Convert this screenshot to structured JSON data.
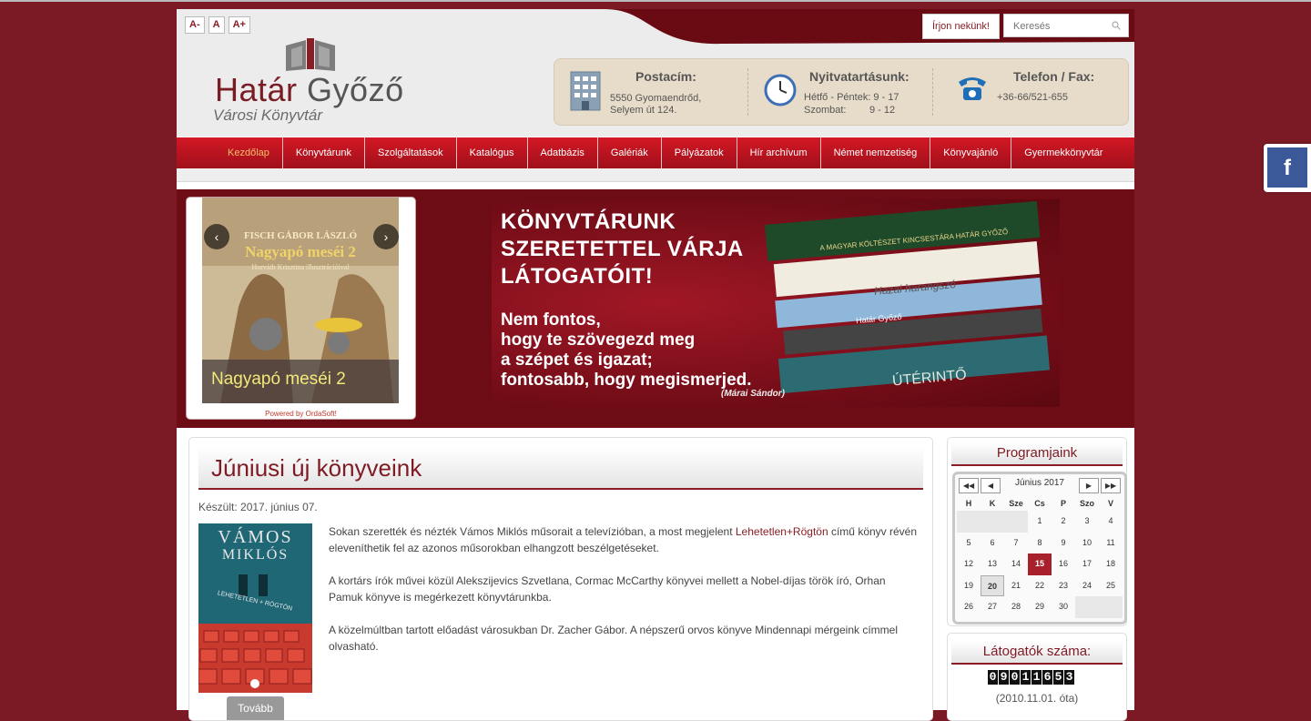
{
  "header": {
    "font_sizes": [
      "A-",
      "A",
      "A+"
    ],
    "logo_title_a": "Határ",
    "logo_title_b": "Győző",
    "logo_sub": "Városi Könyvtár",
    "write_us": "Írjon nekünk!",
    "search_placeholder": "Keresés",
    "postal_title": "Postacím:",
    "postal_line1": "5550 Gyomaendrőd,",
    "postal_line2": "Selyem út 124.",
    "hours_title": "Nyitvatartásunk:",
    "hours_line1": "Hétfő - Péntek: 9 - 17",
    "hours_line2_label": "Szombat:",
    "hours_line2_value": "9 - 12",
    "phone_title": "Telefon / Fax:",
    "phone_value": "+36-66/521-655"
  },
  "nav": {
    "items": [
      "Kezdőlap",
      "Könyvtárunk",
      "Szolgáltatások",
      "Katalógus",
      "Adatbázis",
      "Galériák",
      "Pályázatok",
      "Hír archívum",
      "Német nemzetiség",
      "Könyvajánló",
      "Gyermekkönyvtár"
    ]
  },
  "slider": {
    "book_author": "FISCH GÁBOR LÁSZLÓ",
    "book_title": "Nagyapó meséi 2",
    "book_sub": "Horváth Krisztina illusztrációival",
    "caption": "Nagyapó meséi 2",
    "powered": "Powered by OrdaSoft!",
    "prev": "‹",
    "next": "›"
  },
  "banner": {
    "line1": "KÖNYVTÁRUNK",
    "line2": "SZERETETTEL VÁRJA",
    "line3": "LÁTOGATÓIT!",
    "quote1": "Nem fontos,",
    "quote2": "hogy te szövegezd meg",
    "quote3": "a szépet és igazat;",
    "quote4": "fontosabb, hogy megismerjed.",
    "author": "(Márai Sándor)",
    "spine1": "A MAGYAR KÖLTÉSZET KINCSESTÁRA HATÁR GYŐZŐ",
    "spine2": "Hazai harangszó",
    "spine3": "Határ Győző",
    "spine4": "ÚTÉRINTŐ"
  },
  "article": {
    "title": "Júniusi új könyveink",
    "meta": "Készült: 2017. június 07.",
    "cover_author_1": "VÁMOS",
    "cover_author_2": "MIKLÓS",
    "cover_title": "LEHETETLEN + RÖGTÖN",
    "p1_a": "Sokan szerették és nézték Vámos Miklós műsorait a televízióban, a most megjelent ",
    "p1_link": "Lehetetlen+Rögtön",
    "p1_b": " című könyv révén eleveníthetik fel az azonos műsorokban elhangzott beszélgetéseket.",
    "p2": "A kortárs írók művei közül Alekszijevics Szvetlana, Cormac McCarthy könyvei mellett a Nobel-díjas török író, Orhan Pamuk könyve is megérkezett könyvtárunkba.",
    "p3": "A közelmúltban tartott előadást városukban Dr. Zacher Gábor. A népszerű orvos könyve Mindennapi mérgeink címmel olvasható.",
    "more": "Tovább"
  },
  "programs": {
    "title": "Programjaink",
    "month": "Június 2017",
    "nav_prev_year": "◀◀",
    "nav_prev": "◀",
    "nav_next": "▶",
    "nav_next_year": "▶▶",
    "weekdays": [
      "H",
      "K",
      "Sze",
      "Cs",
      "P",
      "Szo",
      "V"
    ],
    "weeks": [
      [
        "",
        "",
        "",
        "1",
        "2",
        "3",
        "4"
      ],
      [
        "5",
        "6",
        "7",
        "8",
        "9",
        "10",
        "11"
      ],
      [
        "12",
        "13",
        "14",
        "15",
        "16",
        "17",
        "18"
      ],
      [
        "19",
        "20",
        "21",
        "22",
        "23",
        "24",
        "25"
      ],
      [
        "26",
        "27",
        "28",
        "29",
        "30",
        "",
        ""
      ]
    ],
    "event_day": "15",
    "today": "20"
  },
  "visitors": {
    "title": "Látogatók száma:",
    "digits": [
      "0",
      "9",
      "0",
      "1",
      "1",
      "6",
      "5",
      "3"
    ],
    "since": "(2010.11.01. óta)"
  },
  "social": {
    "fb": "f"
  },
  "colors": {
    "background": "#7b1a24",
    "accent": "#8a1e26",
    "nav": "#c3151f",
    "info_bar": "#e7dcc9"
  }
}
